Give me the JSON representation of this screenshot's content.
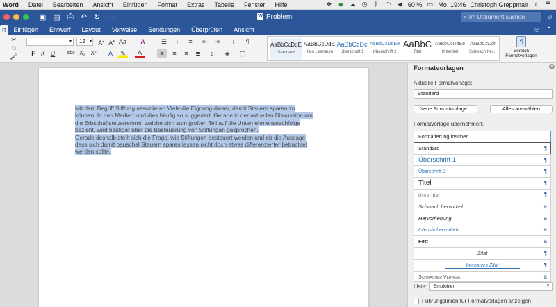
{
  "menubar": {
    "app": "Word",
    "items": [
      "Datei",
      "Bearbeiten",
      "Ansicht",
      "Einfügen",
      "Format",
      "Extras",
      "Tabelle",
      "Fenster",
      "Hilfe"
    ],
    "battery": "60 %",
    "clock": "Mo. 19:46",
    "user": "Christoph Greppmair"
  },
  "titlebar": {
    "document_title": "Problem",
    "search_placeholder": "Im Dokument suchen"
  },
  "tabs": [
    "rt",
    "Einfügen",
    "Entwurf",
    "Layout",
    "Verweise",
    "Sendungen",
    "Überprüfen",
    "Ansicht"
  ],
  "ribbon": {
    "font_name": "",
    "font_size": "12",
    "gallery": [
      {
        "preview": "AaBbCcDdE",
        "name": "Standard"
      },
      {
        "preview": "AaBbCcDdE",
        "name": "Kein Leerraum"
      },
      {
        "preview": "AaBbCcDc",
        "name": "Überschrift 1"
      },
      {
        "preview": "AaBbCcDdEe",
        "name": "Überschrift 2"
      },
      {
        "preview": "AaBbC",
        "name": "Titel"
      },
      {
        "preview": "AaBbCcDdEe",
        "name": "Untertitel"
      },
      {
        "preview": "AaBbCcDdI",
        "name": "Schwach her..."
      }
    ],
    "bereich_label": "Bereich Formatvorlagen"
  },
  "document": {
    "paragraphs": [
      "Mit dem Begriff Stiftung assoziieren Viele die Eignung dieser, damit Steuern sparen zu können. In den Medien wird dies häufig so suggeriert. Gerade in der aktuellen Diskussion um die Erbschaftsteuerreform, welche sich zum großen Teil auf die Unternehmensnachfolge bezieht, wird häufiger über die Besteuerung von Stiftungen gesprochen.",
      "Gerade deshalb stellt sich die Frage, wie Stiftungen besteuert werden und ob die Aussage, dass sich damit pauschal Steuern sparen lassen nicht doch etwas differenzierter betrachtet werden sollte."
    ]
  },
  "pane": {
    "title": "Formatvorlagen",
    "current_label": "Aktuelle Formatvorlage:",
    "current_value": "Standard",
    "new_button": "Neue Formatvorlage...",
    "select_all_button": "Alles auswählen",
    "apply_label": "Formatvorlage übernehmen:",
    "styles": [
      {
        "name": "Formatierung löschen",
        "mark": ""
      },
      {
        "name": "Standard",
        "mark": "¶"
      },
      {
        "name": "Überschrift 1",
        "mark": "¶"
      },
      {
        "name": "Überschrift 2",
        "mark": "¶"
      },
      {
        "name": "Titel",
        "mark": "¶"
      },
      {
        "name": "Untertitel",
        "mark": "¶"
      },
      {
        "name": "Schwach hervorheb.",
        "mark": "a"
      },
      {
        "name": "Hervorhebung",
        "mark": "a"
      },
      {
        "name": "Intensiv hervorheb.",
        "mark": "a"
      },
      {
        "name": "Fett",
        "mark": "a"
      },
      {
        "name": "Zitat",
        "mark": "¶"
      },
      {
        "name": "Intensives Zitat",
        "mark": "¶"
      },
      {
        "name": "Schwacher Verweis",
        "mark": "a"
      }
    ],
    "list_label": "Liste:",
    "list_value": "Empfohlen",
    "guides_label": "Führungslinien für Formatvorlagen anzeigen"
  },
  "colors": {
    "word_blue": "#2b579a",
    "selection": "#b3c9ea",
    "accent": "#5b9bd5"
  }
}
